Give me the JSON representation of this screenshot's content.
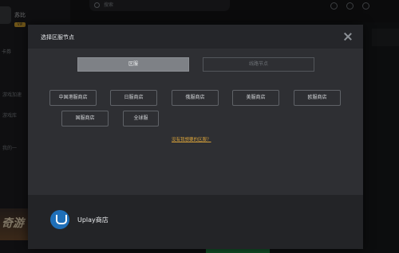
{
  "app": {
    "username": "苏比",
    "badge": "VIP",
    "count": "卡券",
    "nav": [
      "游戏加速",
      "游戏库",
      "我的一"
    ],
    "banner": "奇游",
    "search_placeholder": "搜索"
  },
  "dialog": {
    "title": "选择区服节点",
    "tabs": [
      {
        "label": "区服",
        "active": true
      },
      {
        "label": "线路节点",
        "active": false
      }
    ],
    "regions": [
      "中国港服商店",
      "日服商店",
      "俄服商店",
      "美服商店",
      "欧服商店",
      "国服商店",
      "全球服"
    ],
    "help_link": "没有我想要的区服？",
    "game": {
      "name": "Uplay商店",
      "icon": "uplay-icon"
    }
  },
  "colors": {
    "accent_link": "#d8a23a",
    "uplay_blue": "#1f6fb8",
    "green_button": "#1f8c45"
  }
}
